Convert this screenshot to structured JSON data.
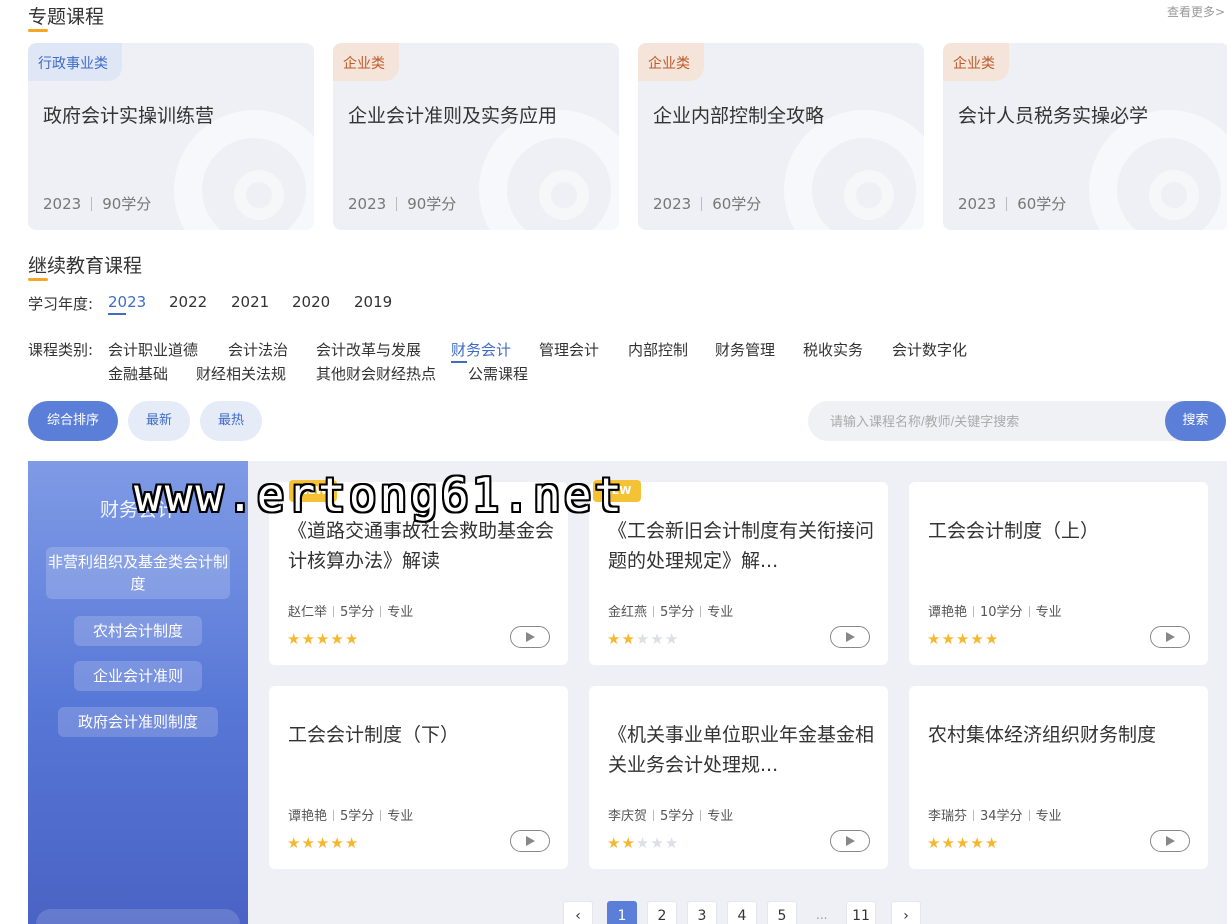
{
  "special": {
    "title": "专题课程",
    "more": "查看更多>",
    "cards": [
      {
        "tag": "行政事业类",
        "name": "政府会计实操训练营",
        "year": "2023",
        "credits": "90学分"
      },
      {
        "tag": "企业类",
        "name": "企业会计准则及实务应用",
        "year": "2023",
        "credits": "90学分"
      },
      {
        "tag": "企业类",
        "name": "企业内部控制全攻略",
        "year": "2023",
        "credits": "60学分"
      },
      {
        "tag": "企业类",
        "name": "会计人员税务实操必学",
        "year": "2023",
        "credits": "60学分"
      }
    ]
  },
  "continuing": {
    "title": "继续教育课程",
    "year_label": "学习年度:",
    "years": [
      "2023",
      "2022",
      "2021",
      "2020",
      "2019"
    ],
    "category_label": "课程类别:",
    "categories": [
      "会计职业道德",
      "会计法治",
      "会计改革与发展",
      "财务会计",
      "管理会计",
      "内部控制",
      "财务管理",
      "税收实务",
      "会计数字化",
      "金融基础",
      "财经相关法规",
      "其他财会财经热点",
      "公需课程"
    ],
    "sort": [
      "综合排序",
      "最新",
      "最热"
    ],
    "search": {
      "placeholder": "请输入课程名称/教师/关键字搜索",
      "button": "搜索"
    }
  },
  "sidebar": {
    "title": "财务会计",
    "items": [
      "非营利组织及基金类会计制度",
      "农村会计制度",
      "企业会计准则",
      "政府会计准则制度"
    ]
  },
  "courses": [
    {
      "title": "《道路交通事故社会救助基金会计核算办法》解读",
      "teacher": "赵仁举",
      "credits": "5学分",
      "type": "专业",
      "rating": 5
    },
    {
      "title": "《工会新旧会计制度有关衔接问题的处理规定》解...",
      "teacher": "金红燕",
      "credits": "5学分",
      "type": "专业",
      "rating": 2
    },
    {
      "title": "工会会计制度（上）",
      "teacher": "谭艳艳",
      "credits": "10学分",
      "type": "专业",
      "rating": 5
    },
    {
      "title": "工会会计制度（下）",
      "teacher": "谭艳艳",
      "credits": "5学分",
      "type": "专业",
      "rating": 5
    },
    {
      "title": "《机关事业单位职业年金基金相关业务会计处理规...",
      "teacher": "李庆贺",
      "credits": "5学分",
      "type": "专业",
      "rating": 2
    },
    {
      "title": "农村集体经济组织财务制度",
      "teacher": "李瑞芬",
      "credits": "34学分",
      "type": "专业",
      "rating": 5
    }
  ],
  "badges": {
    "new": "NEW"
  },
  "pagination": {
    "pages": [
      "1",
      "2",
      "3",
      "4",
      "5",
      "11"
    ],
    "ellipsis": "...",
    "prev": "‹",
    "next": "›"
  },
  "watermark": "www.ertong61.net",
  "colors": {
    "accent": "#5b7fd9",
    "highlight": "#3e6cc6",
    "star": "#f5b82e",
    "underline": "#f5a623"
  }
}
